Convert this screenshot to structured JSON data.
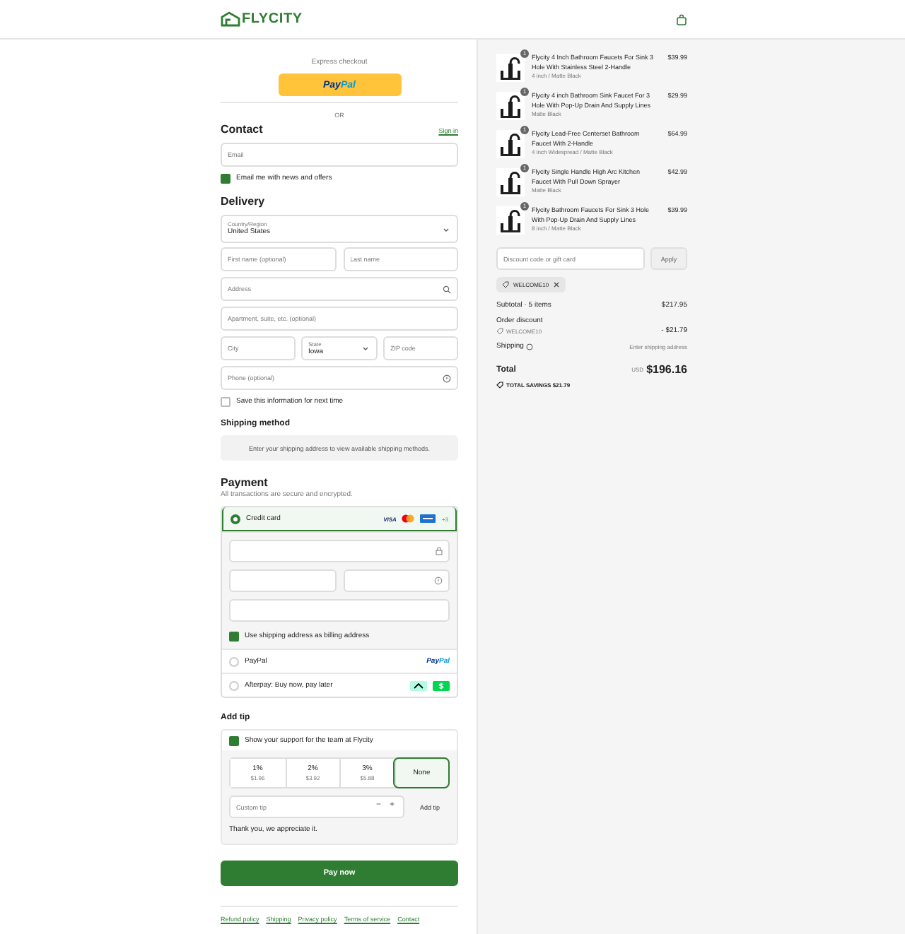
{
  "header": {
    "logo": "FLYCITY"
  },
  "express": {
    "label": "Express checkout",
    "button": {
      "brand_a": "Pay",
      "brand_b": "Pal"
    },
    "divider": "OR"
  },
  "contact": {
    "title": "Contact",
    "sign_in": "Sign in",
    "email": {
      "placeholder": "Email"
    },
    "newsletter": {
      "label": "Email me with news and offers",
      "checked": true
    }
  },
  "delivery": {
    "title": "Delivery",
    "country": {
      "label": "Country/Region",
      "value": "United States"
    },
    "first_name": {
      "placeholder": "First name (optional)"
    },
    "last_name": {
      "placeholder": "Last name"
    },
    "address": {
      "placeholder": "Address"
    },
    "apartment": {
      "placeholder": "Apartment, suite, etc. (optional)"
    },
    "city": {
      "placeholder": "City"
    },
    "state": {
      "label": "State",
      "value": "Iowa"
    },
    "zip": {
      "placeholder": "ZIP code"
    },
    "phone": {
      "placeholder": "Phone (optional)"
    },
    "save_info": {
      "label": "Save this information for next time",
      "checked": false
    }
  },
  "shipping_method": {
    "title": "Shipping method",
    "message": "Enter your shipping address to view available shipping methods."
  },
  "payment": {
    "title": "Payment",
    "subtitle": "All transactions are secure and encrypted.",
    "methods": [
      {
        "kind": "card",
        "label": "Credit card",
        "selected": true,
        "visa": "VISA",
        "more": "+3",
        "billing": {
          "label": "Use shipping address as billing address",
          "checked": true
        }
      },
      {
        "kind": "paypal",
        "label": "PayPal",
        "selected": false,
        "brand_a": "Pay",
        "brand_b": "Pal"
      },
      {
        "kind": "afterpay",
        "label": "Afterpay: Buy now, pay later",
        "selected": false
      }
    ]
  },
  "tip": {
    "title": "Add tip",
    "support": {
      "label": "Show your support for the team at Flycity",
      "checked": true
    },
    "options": [
      {
        "percent": "1%",
        "amount": "$1.96",
        "selected": false
      },
      {
        "percent": "2%",
        "amount": "$3.92",
        "selected": false
      },
      {
        "percent": "3%",
        "amount": "$5.88",
        "selected": false
      },
      {
        "percent": "None",
        "selected": true
      }
    ],
    "custom": {
      "placeholder": "Custom tip",
      "minus": "−",
      "plus": "+"
    },
    "add_button": "Add tip",
    "thanks": "Thank you, we appreciate it."
  },
  "pay_button": "Pay now",
  "footer_links": [
    "Refund policy",
    "Shipping",
    "Privacy policy",
    "Terms of service",
    "Contact"
  ],
  "items": [
    {
      "name": "Flycity 4 Inch Bathroom Faucets For Sink 3 Hole With Stainless Steel 2-Handle",
      "variant": "4 inch / Matte Black",
      "price": "$39.99",
      "quantity": "1"
    },
    {
      "name": "Flycity 4 inch Bathroom Sink Faucet For 3 Hole With Pop-Up Drain And Supply Lines",
      "variant": "Matte Black",
      "price": "$29.99",
      "quantity": "1"
    },
    {
      "name": "Flycity Lead-Free Centerset Bathroom Faucet With 2-Handle",
      "variant": "4 inch Widespread / Matte Black",
      "price": "$64.99",
      "quantity": "1"
    },
    {
      "name": "Flycity Single Handle High Arc Kitchen Faucet With Pull Down Sprayer",
      "variant": "Matte Black",
      "price": "$42.99",
      "quantity": "1"
    },
    {
      "name": "Flycity Bathroom Faucets For Sink 3 Hole With Pop-Up Drain And Supply Lines",
      "variant": "8 inch / Matte Black",
      "price": "$39.99",
      "quantity": "1"
    }
  ],
  "discount": {
    "placeholder": "Discount code or gift card",
    "apply": "Apply",
    "code": "WELCOME10"
  },
  "summary": {
    "subtotal_label": "Subtotal · 5 items",
    "subtotal": "$217.95",
    "discount_label": "Order discount",
    "discount_code": "WELCOME10",
    "discount_amount": "- $21.79",
    "shipping_label": "Shipping",
    "shipping_value": "Enter shipping address",
    "total_label": "Total",
    "currency": "USD",
    "total": "$196.16",
    "savings": "**TOTAL SAVINGS  $21.79**"
  }
}
